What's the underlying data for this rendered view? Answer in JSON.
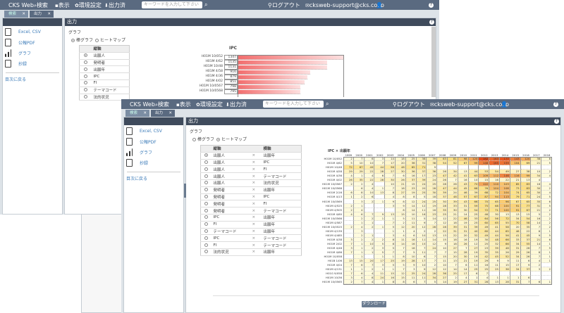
{
  "app": {
    "title": "CKS Web",
    "nav": {
      "search": "検索",
      "view": "表示",
      "settings": "環境設定",
      "exported": "出力済",
      "search_placeholder": "キーワードを入力して下さい",
      "logout": "ログアウト",
      "email": "cksweb-support@cks.co.jp"
    }
  },
  "tabs": [
    {
      "label": "検索"
    },
    {
      "label": "出力"
    }
  ],
  "sidebar": {
    "items": [
      {
        "label": "Excel, CSV",
        "icon": "file-icon"
      },
      {
        "label": "公報PDF",
        "icon": "pdf-icon"
      },
      {
        "label": "グラフ",
        "icon": "bar-chart-icon"
      },
      {
        "label": "抄録",
        "icon": "abstract-icon"
      }
    ],
    "back_link": "目次に戻る"
  },
  "panel_title": "出力",
  "section_title": "グラフ",
  "graph_types": [
    "棒グラフ",
    "ヒートマップ"
  ],
  "back_window": {
    "selected_graph_type": "棒グラフ",
    "axis_header": "縦軸",
    "axis_options": [
      "出願人",
      "発明者",
      "出願年",
      "IPC",
      "FI",
      "テーマコード",
      "法的状況"
    ],
    "selected": "出願人"
  },
  "front_window": {
    "selected_graph_type": "ヒートマップ",
    "headers": {
      "vertical": "縦軸",
      "horizontal": "横軸"
    },
    "pairs": [
      [
        "出願人",
        "出願年"
      ],
      [
        "出願人",
        "IPC"
      ],
      [
        "出願人",
        "FI"
      ],
      [
        "出願人",
        "テーマコード"
      ],
      [
        "出願人",
        "法的状況"
      ],
      [
        "発明者",
        "出願年"
      ],
      [
        "発明者",
        "IPC"
      ],
      [
        "発明者",
        "FI"
      ],
      [
        "発明者",
        "テーマコード"
      ],
      [
        "IPC",
        "出願年"
      ],
      [
        "FI",
        "出願年"
      ],
      [
        "テーマコード",
        "出願年"
      ],
      [
        "IPC",
        "テーマコード"
      ],
      [
        "FI",
        "テーマコード"
      ],
      [
        "法的状況",
        "出願年"
      ]
    ],
    "cross": "×",
    "download": "ダウンロード"
  },
  "colors": {
    "nav": "#5a6a80",
    "panel_header": "#3f4b5c",
    "link": "#3a7ab8",
    "bar": "#f26d6d",
    "heat_low": "#fffbe0",
    "heat_mid": "#fde68a",
    "heat_high": "#e8501a"
  },
  "chart_data": [
    {
      "type": "bar",
      "orientation": "horizontal",
      "title": "IPC",
      "categories": [
        "H01M 10/052",
        "H01M 4/62",
        "H01M 10/48",
        "H01M 4/58",
        "H01M 4/36",
        "H01M 4/02",
        "H01M 10/0567",
        "H01M 10/0568"
      ],
      "values": [
        1347,
        1135,
        1131,
        916,
        879,
        851,
        798,
        795
      ]
    },
    {
      "type": "heatmap",
      "title": "IPC × 出願年",
      "x": [
        "1999",
        "2000",
        "2001",
        "2002",
        "2003",
        "2004",
        "2005",
        "2006",
        "2007",
        "2008",
        "2009",
        "2010",
        "2011",
        "2012",
        "2013",
        "2014",
        "2015",
        "2016",
        "2017",
        "2018"
      ],
      "y": [
        "H01M 10/052",
        "H01M 4/62",
        "H01M 10/48",
        "H01M 4/58",
        "H01M 4/36",
        "H01M 4/02",
        "H01M 10/0567",
        "H01M 10/0568",
        "H01M 2/16",
        "H01M 4/13",
        "H01M 10/0569",
        "H01M 4/525",
        "H01M 4/505",
        "H01M 4/60",
        "H01M 10/0566",
        "H01M 4/587",
        "H01M 10/0525",
        "H01M 4/139",
        "H01M 4/485",
        "H01M 4/38",
        "H01M 2/02",
        "H01M 4/48",
        "H01M 4/66",
        "H01M 10/058",
        "H01B 1/06",
        "H01M 4/04",
        "H01M 4/131",
        "H01G 9/058",
        "H01M 10/36",
        "H01M 10/0565"
      ],
      "values": [
        [
          2,
          7,
          6,
          3,
          14,
          18,
          25,
          38,
          39,
          63,
          81,
          98,
          120,
          182,
          163,
          177,
          143,
          120,
          38,
          8
        ],
        [
          5,
          10,
          10,
          7,
          17,
          20,
          36,
          31,
          38,
          54,
          52,
          67,
          99,
          148,
          165,
          159,
          104,
          69,
          21,
          5
        ],
        [
          72,
          67,
          49,
          44,
          56,
          48,
          65,
          71,
          9,
          null,
          null,
          null,
          null,
          null,
          null,
          null,
          null,
          null,
          null,
          null
        ],
        [
          29,
          29,
          22,
          28,
          27,
          30,
          36,
          37,
          36,
          26,
          34,
          13,
          44,
          53,
          54,
          49,
          27,
          38,
          10,
          2
        ],
        [
          4,
          1,
          4,
          6,
          7,
          6,
          16,
          17,
          23,
          47,
          42,
          41,
          63,
          109,
          112,
          146,
          116,
          99,
          34,
          4
        ],
        [
          26,
          35,
          22,
          28,
          30,
          26,
          37,
          39,
          24,
          26,
          7,
          16,
          10,
          15,
          16,
          22,
          21,
          13,
          4,
          null
        ],
        [
          2,
          2,
          4,
          null,
          10,
          21,
          15,
          24,
          25,
          28,
          26,
          43,
          70,
          122,
          110,
          103,
          85,
          83,
          16,
          4
        ],
        [
          null,
          6,
          4,
          1,
          7,
          18,
          23,
          20,
          28,
          47,
          44,
          45,
          68,
          76,
          104,
          108,
          73,
          83,
          30,
          2
        ],
        [
          6,
          8,
          10,
          13,
          8,
          27,
          19,
          25,
          30,
          39,
          24,
          46,
          39,
          68,
          72,
          104,
          74,
          65,
          30,
          4
        ],
        [
          1,
          2,
          6,
          null,
          4,
          8,
          8,
          5,
          18,
          37,
          48,
          57,
          67,
          87,
          94,
          113,
          79,
          71,
          24,
          5
        ],
        [
          null,
          3,
          2,
          1,
          9,
          8,
          12,
          24,
          25,
          30,
          39,
          43,
          66,
          70,
          65,
          96,
          67,
          65,
          35,
          6
        ],
        [
          2,
          1,
          null,
          null,
          3,
          9,
          14,
          12,
          19,
          28,
          33,
          31,
          59,
          75,
          68,
          100,
          91,
          77,
          31,
          5
        ],
        [
          2,
          4,
          null,
          null,
          null,
          8,
          14,
          11,
          16,
          35,
          30,
          30,
          54,
          72,
          71,
          100,
          91,
          67,
          21,
          2
        ],
        [
          4,
          6,
          7,
          9,
          13,
          15,
          10,
          16,
          23,
          25,
          21,
          14,
          25,
          46,
          30,
          13,
          13,
          15,
          5,
          2
        ],
        [
          null,
          2,
          2,
          1,
          1,
          5,
          11,
          5,
          14,
          12,
          22,
          46,
          33,
          64,
          56,
          72,
          34,
          54,
          16,
          2
        ],
        [
          null,
          1,
          1,
          null,
          7,
          2,
          11,
          9,
          7,
          12,
          18,
          19,
          25,
          60,
          65,
          55,
          70,
          58,
          14,
          2
        ],
        [
          2,
          4,
          2,
          1,
          5,
          12,
          20,
          12,
          28,
          28,
          39,
          31,
          39,
          49,
          41,
          58,
          20,
          35,
          7,
          2
        ],
        [
          null,
          3,
          null,
          null,
          1,
          1,
          4,
          2,
          2,
          22,
          31,
          31,
          40,
          60,
          44,
          65,
          46,
          22,
          8,
          1
        ],
        [
          null,
          2,
          1,
          null,
          3,
          4,
          6,
          10,
          13,
          13,
          22,
          20,
          32,
          49,
          44,
          56,
          41,
          45,
          9,
          5
        ],
        [
          3,
          2,
          2,
          2,
          8,
          11,
          16,
          11,
          14,
          15,
          18,
          16,
          19,
          30,
          48,
          66,
          33,
          37,
          21,
          6
        ],
        [
          7,
          1,
          10,
          5,
          8,
          14,
          16,
          15,
          12,
          9,
          18,
          26,
          12,
          25,
          32,
          66,
          34,
          55,
          14,
          1
        ],
        [
          3,
          1,
          2,
          3,
          5,
          7,
          16,
          7,
          24,
          10,
          27,
          7,
          27,
          23,
          39,
          48,
          31,
          26,
          7,
          5
        ],
        [
          7,
          1,
          1,
          5,
          7,
          7,
          5,
          11,
          7,
          7,
          15,
          28,
          19,
          35,
          35,
          26,
          29,
          26,
          8,
          1
        ],
        [
          null,
          1,
          null,
          1,
          1,
          8,
          10,
          6,
          7,
          15,
          20,
          30,
          19,
          42,
          45,
          52,
          34,
          26,
          7,
          1
        ],
        [
          13,
          15,
          20,
          17,
          25,
          19,
          28,
          17,
          7,
          11,
          13,
          21,
          19,
          29,
          9,
          9,
          11,
          6,
          4,
          1
        ],
        [
          7,
          6,
          7,
          3,
          5,
          5,
          9,
          10,
          2,
          10,
          7,
          6,
          11,
          16,
          11,
          15,
          17,
          9,
          2,
          null
        ],
        [
          1,
          1,
          2,
          1,
          1,
          7,
          3,
          9,
          12,
          12,
          14,
          14,
          25,
          25,
          25,
          38,
          34,
          37,
          3,
          2
        ],
        [
          7,
          6,
          4,
          11,
          15,
          12,
          25,
          24,
          28,
          36,
          25,
          17,
          6,
          7,
          null,
          null,
          null,
          null,
          null,
          null
        ],
        [
          3,
          4,
          8,
          24,
          16,
          15,
          11,
          11,
          34,
          27,
          2,
          4,
          1,
          4,
          1,
          1,
          1,
          6,
          null,
          null
        ],
        [
          2,
          7,
          4,
          1,
          8,
          8,
          6,
          7,
          5,
          14,
          19,
          27,
          31,
          28,
          13,
          28,
          31,
          7,
          6,
          1
        ]
      ]
    }
  ]
}
